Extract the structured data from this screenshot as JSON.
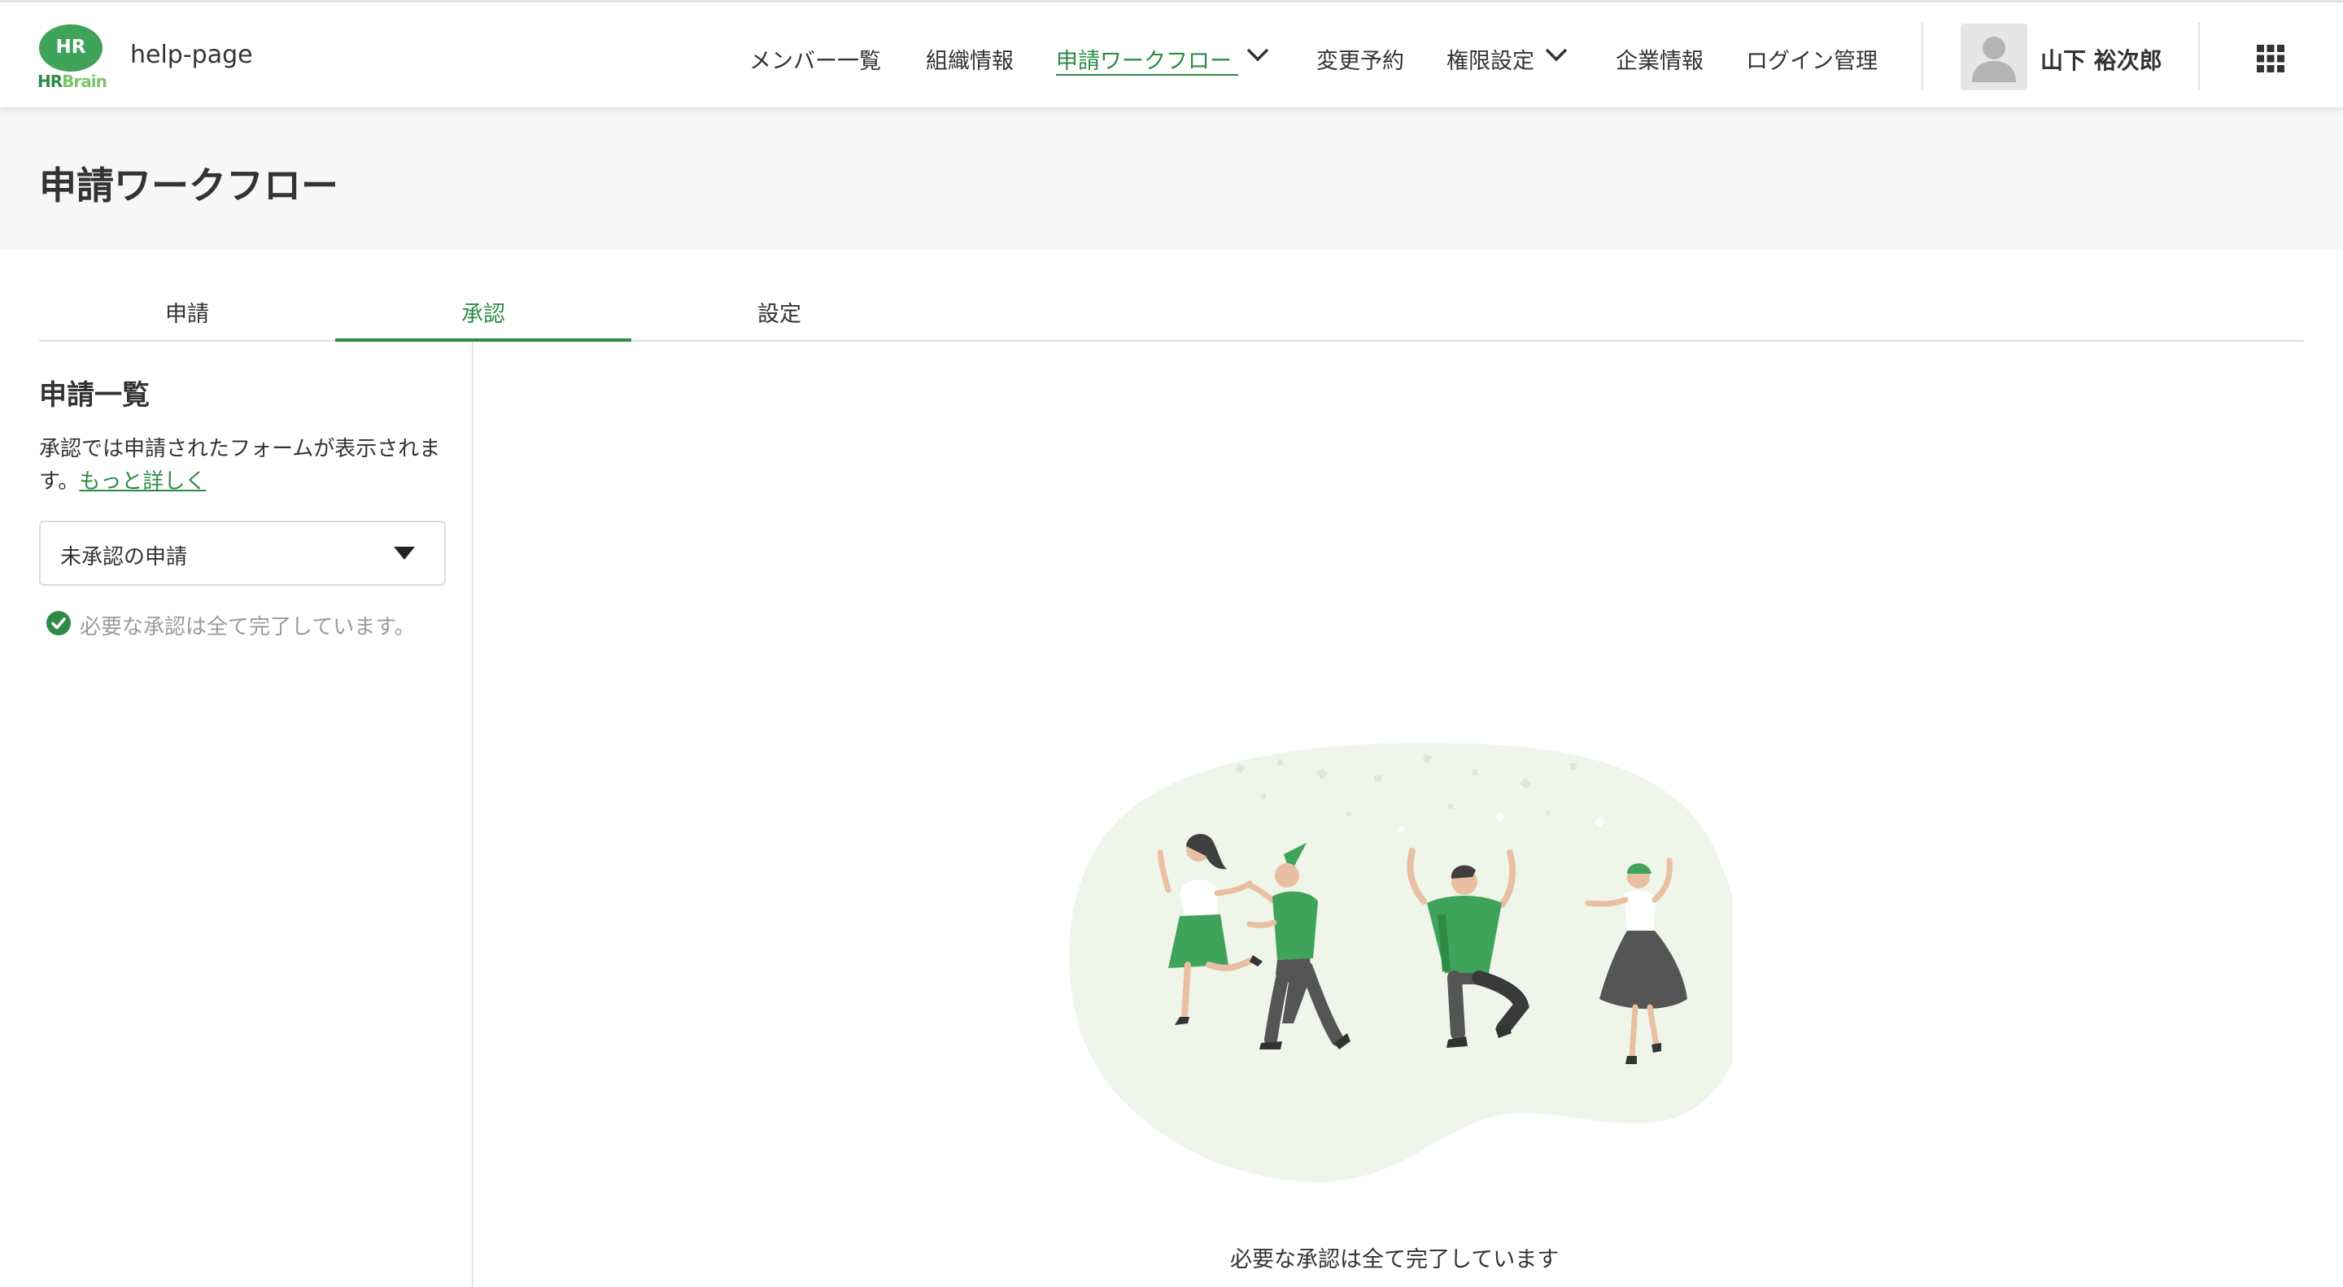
{
  "header": {
    "logo_mark": "HR",
    "logo_word_a": "HR",
    "logo_word_b": "Brain",
    "site_name": "help-page",
    "nav": [
      {
        "label": "メンバー一覧"
      },
      {
        "label": "組織情報"
      },
      {
        "label": "申請ワークフロー"
      },
      {
        "label": "変更予約"
      },
      {
        "label": "権限設定"
      },
      {
        "label": "企業情報"
      },
      {
        "label": "ログイン管理"
      }
    ],
    "user_name": "山下 裕次郎"
  },
  "page": {
    "title": "申請ワークフロー"
  },
  "tabs": [
    {
      "label": "申請"
    },
    {
      "label": "承認"
    },
    {
      "label": "設定"
    }
  ],
  "sidebar": {
    "title": "申請一覧",
    "description": "承認では申請されたフォームが表示されます。",
    "more_link": "もっと詳しく",
    "filter_selected": "未承認の申請",
    "status_message": "必要な承認は全て完了しています。"
  },
  "main": {
    "empty_message": "必要な承認は全て完了しています"
  },
  "colors": {
    "accent": "#2e8b47",
    "logo_green": "#3fa35a",
    "illustration_bg": "#eff5e8"
  },
  "icons": {
    "nav_dropdown": "chevron-down-icon",
    "apps": "apps-grid-icon",
    "status": "check-circle-icon",
    "select": "caret-down-icon"
  }
}
